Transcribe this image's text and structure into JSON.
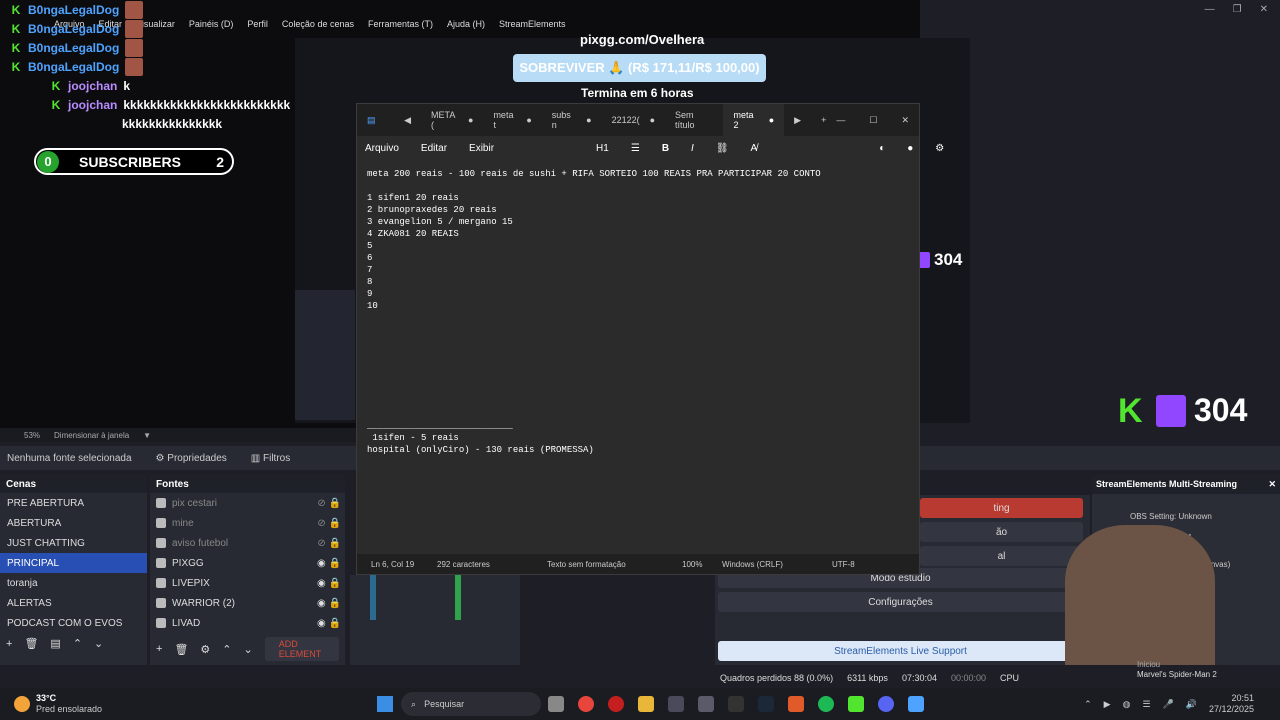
{
  "obs": {
    "menu": [
      "Arquivo",
      "Editar",
      "Visualizar",
      "Painéis (D)",
      "Perfil",
      "Coleção de cenas",
      "Ferramentas (T)",
      "Ajuda (H)",
      "StreamElements"
    ],
    "zoom": "53%",
    "zoom_mode": "Dimensionar à janela",
    "no_source": "Nenhuma fonte selecionada",
    "properties": "Propriedades",
    "filters": "Filtros",
    "scenes_title": "Cenas",
    "scenes": [
      "PRE ABERTURA",
      "ABERTURA",
      "JUST CHATTING",
      "PRINCIPAL",
      "toranja",
      "ALERTAS",
      "PODCAST COM O EVOS"
    ],
    "sources_title": "Fontes",
    "sources": [
      "pix cestari",
      "mine",
      "aviso futebol",
      "PIXGG",
      "LIVEPIX",
      "WARRIOR (2)",
      "LIVAD"
    ],
    "add_element": "ADD ELEMENT",
    "studio_mode": "Modo estúdio",
    "settings": "Configurações",
    "live_support": "StreamElements Live Support",
    "status": {
      "dropped": "Quadros perdidos 88 (0.0%)",
      "kbps": "6311 kbps",
      "rec_time": "07:30:04",
      "rec2": "00:00:00",
      "cpu": "CPU"
    }
  },
  "chat": {
    "lines": [
      {
        "name": "B0ngaLegalDog",
        "msg": ""
      },
      {
        "name": "B0ngaLegalDog",
        "msg": ""
      },
      {
        "name": "B0ngaLegalDog",
        "msg": ""
      },
      {
        "name": "B0ngaLegalDog",
        "msg": ""
      },
      {
        "name": "joojchan",
        "msg": "k"
      },
      {
        "name": "joojchan",
        "msg": "kkkkkkkkkkkkkkkkkkkkkkkkk"
      }
    ],
    "continuation": "kkkkkkkkkkkkkkk"
  },
  "subscribers": {
    "count": "0",
    "label": "SUBSCRIBERS",
    "right": "2"
  },
  "overlay": {
    "pixgg": "pixgg.com/Ovelhera",
    "sobreviver": "SOBREVIVER 🙏 (R$ 171,11/R$ 100,00)",
    "termina": "Termina em 6 horas",
    "twitch_count": "304"
  },
  "notepad": {
    "tabs": [
      "META (",
      "meta t",
      "subs n",
      "22122(",
      "Sem título",
      "meta 2"
    ],
    "menu": [
      "Arquivo",
      "Editar",
      "Exibir"
    ],
    "heading": "H1",
    "text": "meta 200 reais - 100 reais de sushi + RIFA SORTEIO 100 REAIS PRA PARTICIPAR 20 CONTO\n\n1 sifen1 20 reais\n2 brunopraxedes 20 reais\n3 evangelion 5 / mergano 15\n4 ZKA081 20 REAIS\n5\n6\n7\n8\n9\n10\n\n\n\n\n\n\n\n\n\n___________________________\n 1sifen - 5 reais\nhospital (onlyCiro) - 130 reais (PROMESSA)",
    "status": {
      "pos": "Ln 6, Col 19",
      "chars": "292 caracteres",
      "format": "Texto sem formatação",
      "zoom": "100%",
      "eol": "Windows (CRLF)",
      "enc": "UTF-8"
    }
  },
  "se_panel": {
    "title": "StreamElements Multi-Streaming",
    "obs_setting": "OBS Setting: Unknown",
    "account1": "OvelheraM",
    "account2": "hera (Default Canvas)",
    "right_labels": [
      "ting",
      "ão",
      "al"
    ]
  },
  "taskbar": {
    "weather_temp": "33°C",
    "weather_desc": "Pred ensolarado",
    "search": "Pesquisar",
    "time": "20:51",
    "date": "27/12/2025",
    "notif_title": "Iniciou",
    "notif_game": "Marvel's Spider-Man 2"
  },
  "colors": {
    "accent_blue": "#284fb3",
    "twitch": "#9146ff",
    "kick": "#52e52f",
    "live_red": "#c0392b"
  }
}
